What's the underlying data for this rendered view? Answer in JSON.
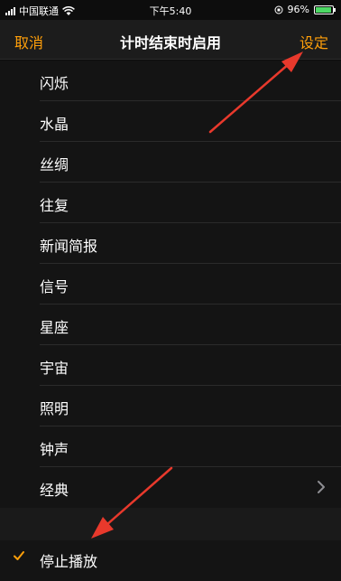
{
  "status_bar": {
    "carrier": "中国联通",
    "time": "下午5:40",
    "battery": "96%",
    "battery_level": 0.96
  },
  "nav": {
    "cancel": "取消",
    "title": "计时结束时启用",
    "set": "设定"
  },
  "items": [
    {
      "label": "闪烁"
    },
    {
      "label": "水晶"
    },
    {
      "label": "丝绸"
    },
    {
      "label": "往复"
    },
    {
      "label": "新闻简报"
    },
    {
      "label": "信号"
    },
    {
      "label": "星座"
    },
    {
      "label": "宇宙"
    },
    {
      "label": "照明"
    },
    {
      "label": "钟声"
    },
    {
      "label": "经典"
    }
  ],
  "stop_playing": {
    "label": "停止播放",
    "checked": true
  },
  "colors": {
    "accent": "#ff9f0a",
    "annotation_arrow": "#e8392c",
    "battery": "#4cd964"
  },
  "icons": {
    "check": "checkmark-icon",
    "chevron": "chevron-right-icon"
  }
}
